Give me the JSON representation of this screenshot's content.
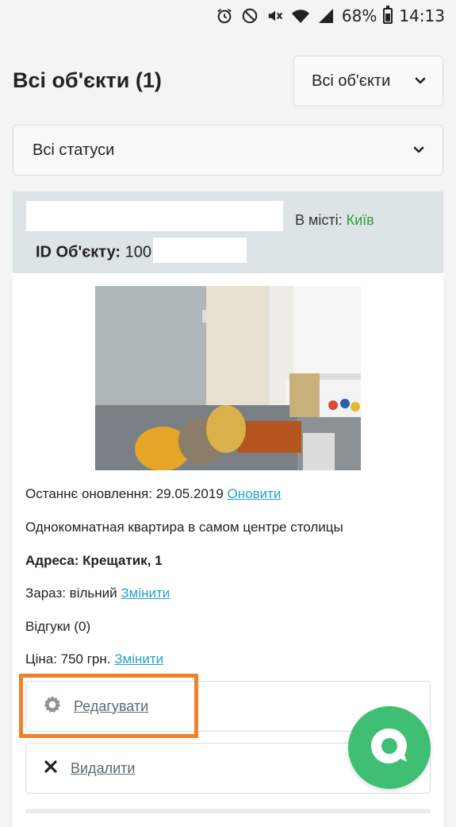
{
  "status_bar": {
    "icons": [
      "alarm-icon",
      "do-not-disturb-icon",
      "mute-icon",
      "wifi-icon",
      "signal-icon"
    ],
    "battery": "68%",
    "time": "14:13"
  },
  "header": {
    "title": "Всі об'єкти (1)",
    "objects_select": "Всі об'єкти",
    "status_select": "Всі статуси"
  },
  "card": {
    "city_label": "В місті:",
    "city_value": "Київ",
    "id_label": "ID Об'єкту:",
    "id_value": "100",
    "last_update_label": "Останнє оновлення: 29.05.2019",
    "refresh_link": "Оновити",
    "description": "Однокомнатная квартира в самом центре столицы",
    "address": "Адреса: Крещатик, 1",
    "now_label": "Зараз: вільний",
    "now_change_link": "Змінити",
    "reviews": "Відгуки (0)",
    "price_label": "Ціна: 750 грн.",
    "price_change_link": "Змінити",
    "edit_button": "Редагувати",
    "delete_button": "Видалити"
  },
  "colors": {
    "accent_link": "#27a0c8",
    "city_green": "#2e9e3a",
    "highlight": "#f0802a",
    "chat_button": "#3fbf73"
  }
}
